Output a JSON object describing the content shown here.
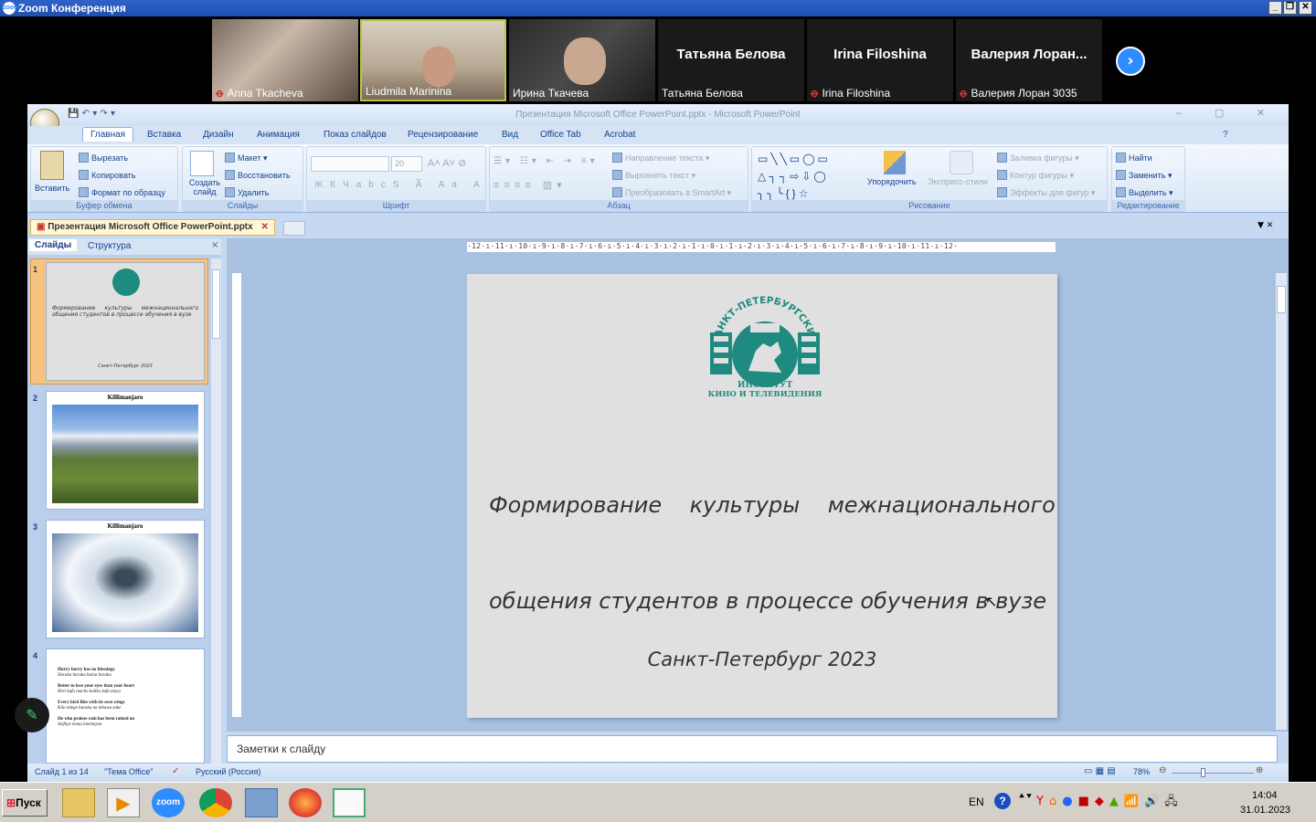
{
  "zoom": {
    "title": "Zoom Конференция",
    "participants": [
      {
        "name": "Anna Tkacheva",
        "muted": true,
        "video": true
      },
      {
        "name": "Liudmila Marinina",
        "muted": false,
        "video": true,
        "active": true
      },
      {
        "name": "Ирина Ткачева",
        "muted": false,
        "video": true
      },
      {
        "name": "Татьяна Белова",
        "display": "Татьяна Белова",
        "muted": false,
        "video": false
      },
      {
        "name": "Irina Filoshina",
        "display": "Irina Filoshina",
        "muted": true,
        "video": false
      },
      {
        "name": "Валерия Лоран 3035",
        "display": "Валерия  Лоран...",
        "muted": true,
        "video": false
      }
    ],
    "next_icon": "chevron-right-icon"
  },
  "ppt": {
    "window_title": "Презентация Microsoft Office PowerPoint.pptx - Microsoft PowerPoint",
    "tabs": [
      "Главная",
      "Вставка",
      "Дизайн",
      "Анимация",
      "Показ слайдов",
      "Рецензирование",
      "Вид",
      "Office Tab",
      "Acrobat"
    ],
    "active_tab": "Главная",
    "clipboard": {
      "paste": "Вставить",
      "cut": "Вырезать",
      "copy": "Копировать",
      "format": "Формат по образцу",
      "label": "Буфер обмена"
    },
    "slides_group": {
      "new_slide": "Создать слайд",
      "layout": "Макет",
      "reset": "Восстановить",
      "delete": "Удалить",
      "label": "Слайды"
    },
    "font_group": {
      "size": "20",
      "label": "Шрифт"
    },
    "paragraph_group": {
      "text_direction": "Направление текста",
      "align_text": "Выровнять текст",
      "smartart": "Преобразовать в SmartArt",
      "label": "Абзац"
    },
    "drawing_group": {
      "arrange": "Упорядочить",
      "quick_styles": "Экспресс-стили",
      "fill": "Заливка фигуры",
      "outline": "Контур фигуры",
      "effects": "Эффекты для фигур",
      "label": "Рисование"
    },
    "editing_group": {
      "find": "Найти",
      "replace": "Заменить",
      "select": "Выделить",
      "label": "Редактирование"
    },
    "doc_tab": "Презентация Microsoft Office PowerPoint.pptx",
    "panel_tabs": {
      "slides": "Слайды",
      "outline": "Структура"
    },
    "thumbs": [
      {
        "num": "1",
        "title": "",
        "text": "Формирование культуры межнационального общения студентов в процессе обучения в вузе",
        "foot": "Санкт-Петербург 2023"
      },
      {
        "num": "2",
        "title": "Killimanjaro"
      },
      {
        "num": "3",
        "title": "Killimanjaro"
      },
      {
        "num": "4",
        "lines": [
          "Hurry hurry has no blessings",
          "Haraka haraka haina baraka",
          "Better to lose your eyes than your heart",
          "Heri kufa macho kuliko kufa moyo",
          "Every bird flies with its own wings",
          "Kila ndege huruka na mbawa zake",
          "He who praises rain has been rained on",
          "Asifuye mvua imemnyea"
        ]
      }
    ],
    "slide": {
      "logo_arc": "САНКТ-ПЕТЕРБУРГСКИЙ ГОСУДАРСТВЕННЫЙ",
      "logo_bottom1": "ИНСТИТУТ",
      "logo_bottom2": "КИНО И ТЕЛЕВИДЕНИЯ",
      "title_line1": "Формирование    культуры    межнационального",
      "title_line2": "общения студентов в процессе обучения в вузе",
      "footer": "Санкт-Петербург 2023"
    },
    "notes_placeholder": "Заметки к слайду",
    "status": {
      "slide": "Слайд 1 из 14",
      "theme": "\"Тема Office\"",
      "lang": "Русский (Россия)",
      "zoom": "78%"
    }
  },
  "taskbar": {
    "start": "Пуск",
    "lang": "EN",
    "time": "14:04",
    "date": "31.01.2023"
  }
}
